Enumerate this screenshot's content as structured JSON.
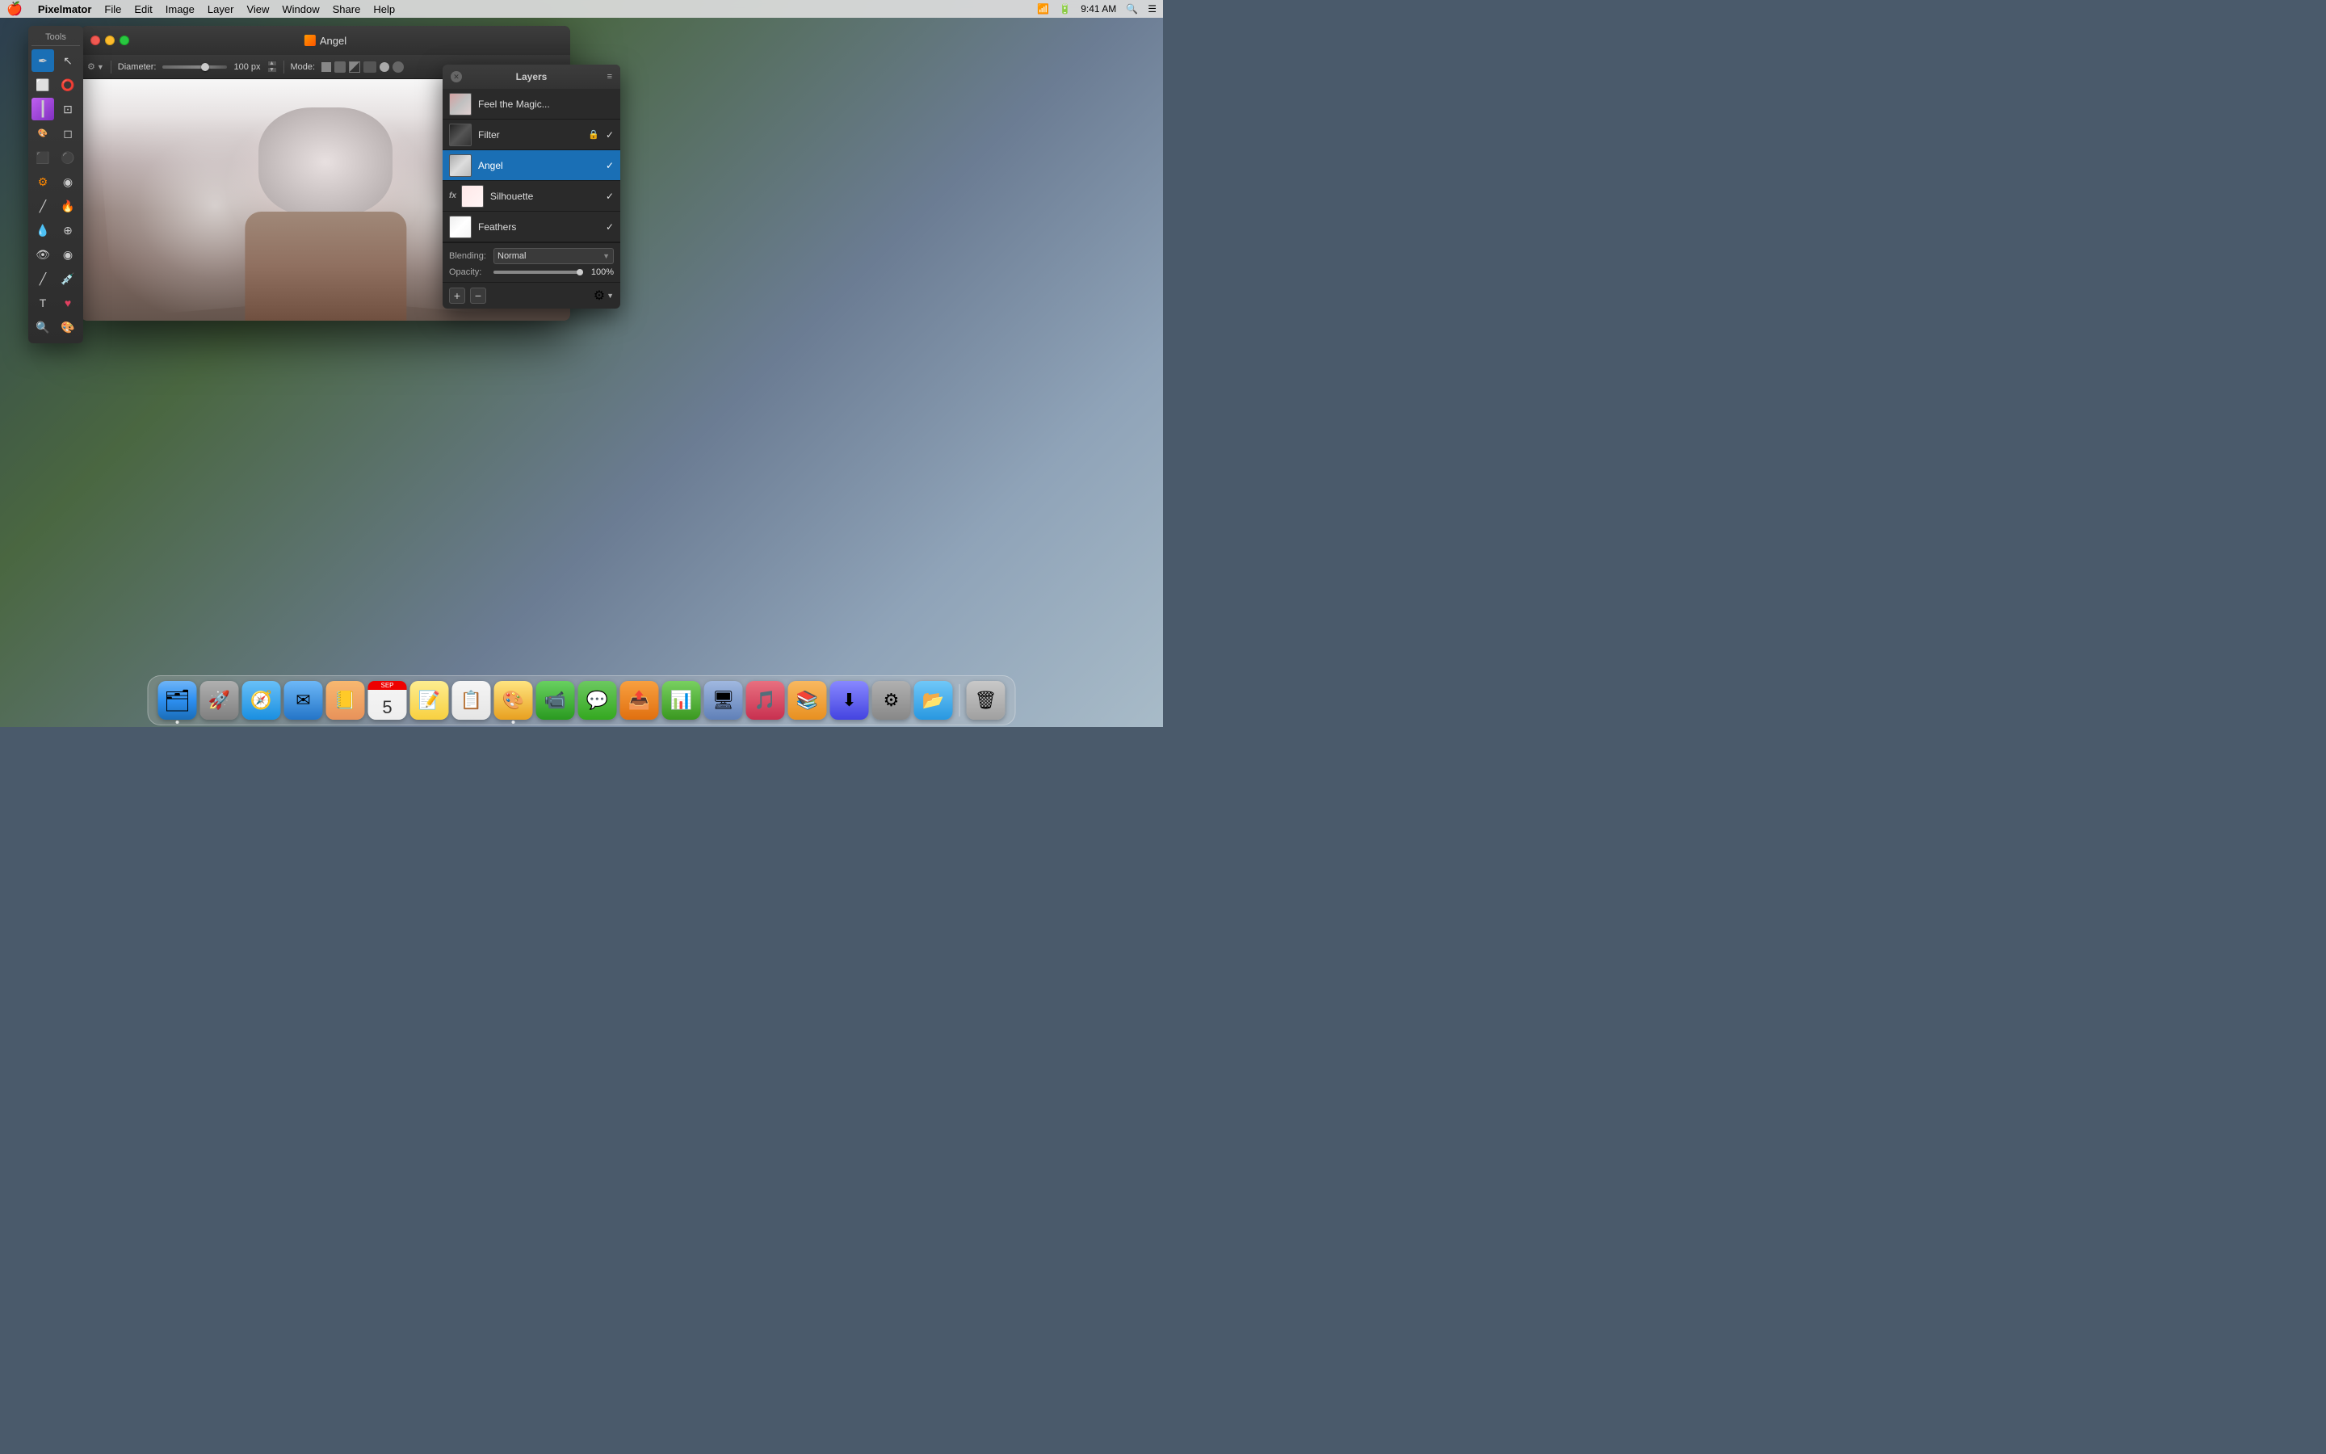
{
  "menubar": {
    "apple": "🍎",
    "app_name": "Pixelmator",
    "menus": [
      "File",
      "Edit",
      "Image",
      "Layer",
      "View",
      "Window",
      "Share",
      "Help"
    ],
    "right": {
      "wifi": "WiFi",
      "battery": "Battery",
      "time": "9:41 AM",
      "search": "🔍",
      "notifications": "☰"
    }
  },
  "window": {
    "title": "Angel",
    "title_icon": "🎨"
  },
  "toolbar": {
    "diameter_label": "Diameter:",
    "diameter_value": "100 px",
    "mode_label": "Mode:",
    "settings_icon": "⚙"
  },
  "tools": {
    "title": "Tools",
    "items": [
      {
        "name": "pen-tool",
        "icon": "✒",
        "active": true
      },
      {
        "name": "selection-arrow",
        "icon": "↖"
      },
      {
        "name": "rect-select",
        "icon": "⬜"
      },
      {
        "name": "ellipse-select",
        "icon": "⭕"
      },
      {
        "name": "paint-brush",
        "icon": "🖌"
      },
      {
        "name": "crop-tool",
        "icon": "⊡"
      },
      {
        "name": "eraser-tool",
        "icon": "◻"
      },
      {
        "name": "eyedropper",
        "icon": "💧"
      },
      {
        "name": "fill-tool",
        "icon": "▪"
      },
      {
        "name": "bucket-fill",
        "icon": "🪣"
      },
      {
        "name": "shape-tool",
        "icon": "⬛"
      },
      {
        "name": "gradient-tool",
        "icon": "⚫"
      },
      {
        "name": "pen-path",
        "icon": "✏"
      },
      {
        "name": "heal-tool",
        "icon": "🔥"
      },
      {
        "name": "smudge-tool",
        "icon": "💧"
      },
      {
        "name": "clone-stamp",
        "icon": "⊕"
      },
      {
        "name": "dodge-burn",
        "icon": "👁"
      },
      {
        "name": "sponge-tool",
        "icon": "◉"
      },
      {
        "name": "line-tool",
        "icon": "╱"
      },
      {
        "name": "paint-bucket",
        "icon": "🔥"
      },
      {
        "name": "text-tool",
        "icon": "T"
      },
      {
        "name": "heart-shape",
        "icon": "♥"
      },
      {
        "name": "zoom-tool",
        "icon": "🔍"
      },
      {
        "name": "color-picker",
        "icon": "🎨"
      }
    ]
  },
  "layers": {
    "title": "Layers",
    "items": [
      {
        "id": "feel-the-magic",
        "name": "Feel the Magic...",
        "thumb_class": "thumb-magic",
        "visible": true,
        "locked": false,
        "has_fx": false,
        "selected": false
      },
      {
        "id": "filter",
        "name": "Filter",
        "thumb_class": "thumb-filter",
        "visible": true,
        "locked": true,
        "has_fx": false,
        "selected": false
      },
      {
        "id": "angel",
        "name": "Angel",
        "thumb_class": "thumb-angel",
        "visible": true,
        "locked": false,
        "has_fx": false,
        "selected": true
      },
      {
        "id": "silhouette",
        "name": "Silhouette",
        "thumb_class": "thumb-silhouette",
        "visible": true,
        "locked": false,
        "has_fx": true,
        "selected": false
      },
      {
        "id": "feathers",
        "name": "Feathers",
        "thumb_class": "thumb-feathers",
        "visible": true,
        "locked": false,
        "has_fx": false,
        "selected": false
      }
    ],
    "blending": {
      "label": "Blending:",
      "value": "Normal"
    },
    "opacity": {
      "label": "Opacity:",
      "value": "100%",
      "percent": 100
    }
  },
  "dock": {
    "items": [
      {
        "name": "finder",
        "icon": "🗂",
        "class": "dock-finder",
        "has_dot": true
      },
      {
        "name": "launchpad",
        "icon": "🚀",
        "class": "dock-launchpad"
      },
      {
        "name": "safari",
        "icon": "🧭",
        "class": "dock-safari"
      },
      {
        "name": "mail",
        "icon": "✉",
        "class": "dock-mail"
      },
      {
        "name": "contacts",
        "icon": "📒",
        "class": "dock-contacts"
      },
      {
        "name": "calendar",
        "icon": "📅",
        "class": "dock-calendar"
      },
      {
        "name": "notes",
        "icon": "📝",
        "class": "dock-notes"
      },
      {
        "name": "reminders",
        "icon": "📋",
        "class": "dock-reminders"
      },
      {
        "name": "pixelmator",
        "icon": "🎨",
        "class": "dock-pixelmator",
        "has_dot": true
      },
      {
        "name": "facetime",
        "icon": "📹",
        "class": "dock-facetime"
      },
      {
        "name": "messages",
        "icon": "💬",
        "class": "dock-messages"
      },
      {
        "name": "file-transfer",
        "icon": "📤",
        "class": "dock-filetransfer"
      },
      {
        "name": "numbers",
        "icon": "📊",
        "class": "dock-numbers"
      },
      {
        "name": "migration",
        "icon": "🖥",
        "class": "dock-migration"
      },
      {
        "name": "itunes",
        "icon": "🎵",
        "class": "dock-itunes"
      },
      {
        "name": "books",
        "icon": "📚",
        "class": "dock-books"
      },
      {
        "name": "app-store",
        "icon": "⬇",
        "class": "dock-appstore"
      },
      {
        "name": "system-preferences",
        "icon": "⚙",
        "class": "dock-sysprefs"
      },
      {
        "name": "airdrop",
        "icon": "📂",
        "class": "dock-airdrop"
      },
      {
        "name": "trash",
        "icon": "🗑",
        "class": "dock-trash"
      }
    ]
  }
}
